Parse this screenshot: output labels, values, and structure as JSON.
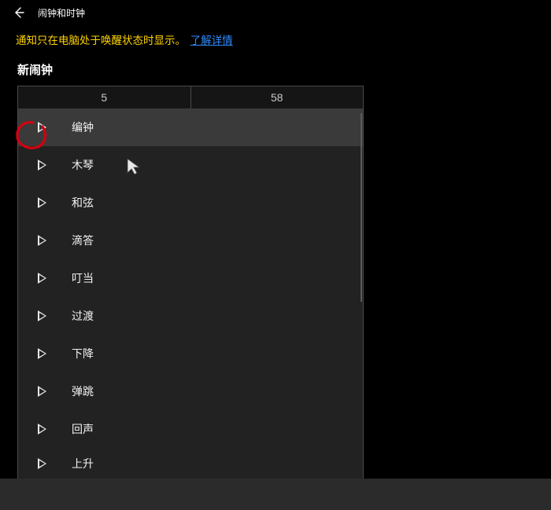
{
  "titlebar": {
    "app_title": "闹钟和时钟"
  },
  "notice": {
    "text": "通知只在电脑处于唤醒状态时显示。",
    "link": "了解详情"
  },
  "section": {
    "header": "新闹钟",
    "time": {
      "hour": "5",
      "minute": "58"
    }
  },
  "sounds": [
    {
      "label": "编钟",
      "selected": true
    },
    {
      "label": "木琴",
      "selected": false
    },
    {
      "label": "和弦",
      "selected": false
    },
    {
      "label": "滴答",
      "selected": false
    },
    {
      "label": "叮当",
      "selected": false
    },
    {
      "label": "过渡",
      "selected": false
    },
    {
      "label": "下降",
      "selected": false
    },
    {
      "label": "弹跳",
      "selected": false
    },
    {
      "label": "回声",
      "selected": false
    },
    {
      "label": "上升",
      "selected": false
    }
  ]
}
